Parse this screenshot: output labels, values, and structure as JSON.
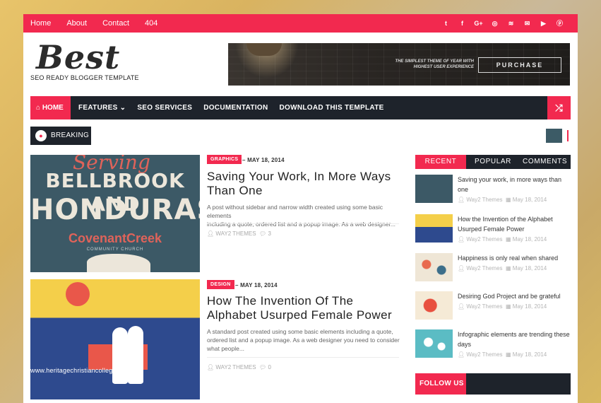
{
  "topbar": {
    "links": [
      "Home",
      "About",
      "Contact",
      "404"
    ],
    "social_icons": [
      "twitter-icon",
      "facebook-icon",
      "google-plus-icon",
      "instagram-icon",
      "rss-icon",
      "email-icon",
      "youtube-icon",
      "pinterest-icon"
    ],
    "social_glyphs": [
      "t",
      "f",
      "G+",
      "◎",
      "≋",
      "✉",
      "▶",
      "ⓟ"
    ]
  },
  "header": {
    "logo": "Best",
    "tagline": "SEO READY BLOGGER TEMPLATE",
    "banner_text": "THE SIMPLEST THEME OF YEAR WITH HIGHEST USER EXPERIENCE",
    "banner_button": "PURCHASE"
  },
  "mainnav": {
    "home": "⌂ HOME",
    "items": [
      "FEATURES ⌄",
      "SEO SERVICES",
      "DOCUMENTATION",
      "DOWNLOAD THIS TEMPLATE"
    ],
    "shuffle_glyph": "⤮"
  },
  "breaking": {
    "label": "BREAKING"
  },
  "posts": [
    {
      "category": "GRAPHICS",
      "date": "– MAY 18, 2014",
      "title_lines": [
        "Saving Your Work, In More Ways",
        "Than One"
      ],
      "excerpt_lines": [
        "A post without sidebar and narrow width created using some basic elements",
        "including a quote, ordered list and a popup image. As a web designer..."
      ],
      "author": "WAY2 THEMES",
      "comments": "3",
      "image_text": {
        "script": "Serving",
        "line1": "BELLBROOK AND",
        "line2": "HONDURAS",
        "line3": "CovenantCreek",
        "line4": "COMMUNITY CHURCH"
      }
    },
    {
      "category": "DESIGN",
      "date": "– MAY 18, 2014",
      "title_lines": [
        "How The Invention Of The",
        "Alphabet Usurped Female Power"
      ],
      "excerpt_lines": [
        "A standard post created using some basic elements including a quote,",
        "ordered list and a popup image. As a web designer you need to consider",
        "what people..."
      ],
      "author": "WAY2 THEMES",
      "comments": "0",
      "watermark": "www.heritagechristiancollege.com"
    }
  ],
  "sidebar": {
    "tabs": [
      "RECENT",
      "POPULAR",
      "COMMENTS"
    ],
    "items": [
      {
        "title": "Saving your work, in more ways than one",
        "author": "Way2 Themes",
        "date": "May 18, 2014",
        "thumb_color": "#3c5966"
      },
      {
        "title": "How the Invention of the Alphabet Usurped Female Power",
        "author": "Way2 Themes",
        "date": "May 18, 2014",
        "thumb_color": "#e9a23b"
      },
      {
        "title": "Happiness is only real when shared",
        "author": "Way2 Themes",
        "date": "May 18, 2014",
        "thumb_color": "#e6dccd"
      },
      {
        "title": "Desiring God Project and be grateful",
        "author": "Way2 Themes",
        "date": "May 18, 2014",
        "thumb_color": "#f0e2c8"
      },
      {
        "title": "Infographic elements are trending these days",
        "author": "Way2 Themes",
        "date": "May 18, 2014",
        "thumb_color": "#5bbcc4"
      }
    ],
    "follow_label": "FOLLOW US"
  },
  "colors": {
    "accent": "#f2294f",
    "dark": "#1e232b"
  }
}
